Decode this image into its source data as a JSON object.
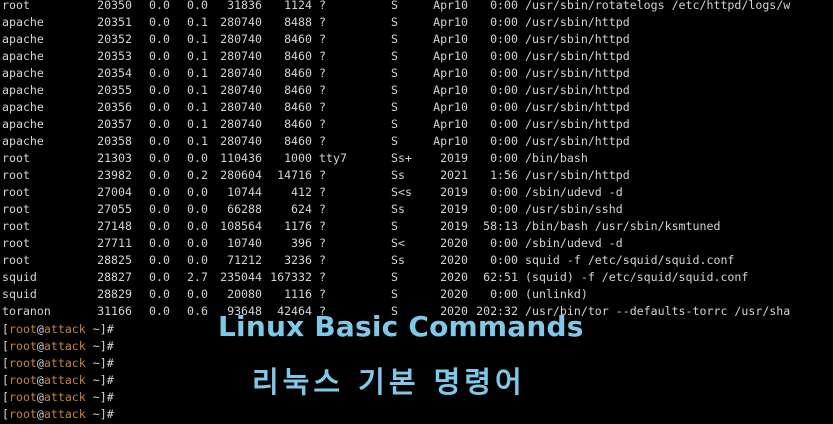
{
  "processes": [
    {
      "user": "root",
      "pid": "20350",
      "cpu": "0.0",
      "mem": "0.0",
      "vsz": "31836",
      "rss": "1124",
      "tty": "?",
      "stat": "S",
      "start": "Apr10",
      "time": "0:00",
      "command": "/usr/sbin/rotatelogs /etc/httpd/logs/w"
    },
    {
      "user": "apache",
      "pid": "20351",
      "cpu": "0.0",
      "mem": "0.1",
      "vsz": "280740",
      "rss": "8488",
      "tty": "?",
      "stat": "S",
      "start": "Apr10",
      "time": "0:00",
      "command": "/usr/sbin/httpd"
    },
    {
      "user": "apache",
      "pid": "20352",
      "cpu": "0.0",
      "mem": "0.1",
      "vsz": "280740",
      "rss": "8460",
      "tty": "?",
      "stat": "S",
      "start": "Apr10",
      "time": "0:00",
      "command": "/usr/sbin/httpd"
    },
    {
      "user": "apache",
      "pid": "20353",
      "cpu": "0.0",
      "mem": "0.1",
      "vsz": "280740",
      "rss": "8460",
      "tty": "?",
      "stat": "S",
      "start": "Apr10",
      "time": "0:00",
      "command": "/usr/sbin/httpd"
    },
    {
      "user": "apache",
      "pid": "20354",
      "cpu": "0.0",
      "mem": "0.1",
      "vsz": "280740",
      "rss": "8460",
      "tty": "?",
      "stat": "S",
      "start": "Apr10",
      "time": "0:00",
      "command": "/usr/sbin/httpd"
    },
    {
      "user": "apache",
      "pid": "20355",
      "cpu": "0.0",
      "mem": "0.1",
      "vsz": "280740",
      "rss": "8460",
      "tty": "?",
      "stat": "S",
      "start": "Apr10",
      "time": "0:00",
      "command": "/usr/sbin/httpd"
    },
    {
      "user": "apache",
      "pid": "20356",
      "cpu": "0.0",
      "mem": "0.1",
      "vsz": "280740",
      "rss": "8460",
      "tty": "?",
      "stat": "S",
      "start": "Apr10",
      "time": "0:00",
      "command": "/usr/sbin/httpd"
    },
    {
      "user": "apache",
      "pid": "20357",
      "cpu": "0.0",
      "mem": "0.1",
      "vsz": "280740",
      "rss": "8460",
      "tty": "?",
      "stat": "S",
      "start": "Apr10",
      "time": "0:00",
      "command": "/usr/sbin/httpd"
    },
    {
      "user": "apache",
      "pid": "20358",
      "cpu": "0.0",
      "mem": "0.1",
      "vsz": "280740",
      "rss": "8460",
      "tty": "?",
      "stat": "S",
      "start": "Apr10",
      "time": "0:00",
      "command": "/usr/sbin/httpd"
    },
    {
      "user": "root",
      "pid": "21303",
      "cpu": "0.0",
      "mem": "0.0",
      "vsz": "110436",
      "rss": "1000",
      "tty": "tty7",
      "stat": "Ss+",
      "start": "2019",
      "time": "0:00",
      "command": "/bin/bash"
    },
    {
      "user": "root",
      "pid": "23982",
      "cpu": "0.0",
      "mem": "0.2",
      "vsz": "280604",
      "rss": "14716",
      "tty": "?",
      "stat": "Ss",
      "start": "2021",
      "time": "1:56",
      "command": "/usr/sbin/httpd"
    },
    {
      "user": "root",
      "pid": "27004",
      "cpu": "0.0",
      "mem": "0.0",
      "vsz": "10744",
      "rss": "412",
      "tty": "?",
      "stat": "S<s",
      "start": "2019",
      "time": "0:00",
      "command": "/sbin/udevd -d"
    },
    {
      "user": "root",
      "pid": "27055",
      "cpu": "0.0",
      "mem": "0.0",
      "vsz": "66288",
      "rss": "624",
      "tty": "?",
      "stat": "Ss",
      "start": "2019",
      "time": "0:00",
      "command": "/usr/sbin/sshd"
    },
    {
      "user": "root",
      "pid": "27148",
      "cpu": "0.0",
      "mem": "0.0",
      "vsz": "108564",
      "rss": "1176",
      "tty": "?",
      "stat": "S",
      "start": "2019",
      "time": "58:13",
      "command": "/bin/bash /usr/sbin/ksmtuned"
    },
    {
      "user": "root",
      "pid": "27711",
      "cpu": "0.0",
      "mem": "0.0",
      "vsz": "10740",
      "rss": "396",
      "tty": "?",
      "stat": "S<",
      "start": "2020",
      "time": "0:00",
      "command": "/sbin/udevd -d"
    },
    {
      "user": "root",
      "pid": "28825",
      "cpu": "0.0",
      "mem": "0.0",
      "vsz": "71212",
      "rss": "3236",
      "tty": "?",
      "stat": "Ss",
      "start": "2020",
      "time": "0:00",
      "command": "squid -f /etc/squid/squid.conf"
    },
    {
      "user": "squid",
      "pid": "28827",
      "cpu": "0.0",
      "mem": "2.7",
      "vsz": "235044",
      "rss": "167332",
      "tty": "?",
      "stat": "S",
      "start": "2020",
      "time": "62:51",
      "command": "(squid) -f /etc/squid/squid.conf"
    },
    {
      "user": "squid",
      "pid": "28829",
      "cpu": "0.0",
      "mem": "0.0",
      "vsz": "20080",
      "rss": "1116",
      "tty": "?",
      "stat": "S",
      "start": "2020",
      "time": "0:00",
      "command": "(unlinkd)"
    },
    {
      "user": "toranon",
      "pid": "31166",
      "cpu": "0.0",
      "mem": "0.6",
      "vsz": "93648",
      "rss": "42464",
      "tty": "?",
      "stat": "S",
      "start": "2020",
      "time": "202:32",
      "command": "/usr/bin/tor --defaults-torrc /usr/sha"
    }
  ],
  "prompts": [
    {
      "open": "[",
      "user": "root",
      "at": "@",
      "host": "attack",
      "cwd": " ~]#"
    },
    {
      "open": "[",
      "user": "root",
      "at": "@",
      "host": "attack",
      "cwd": " ~]#"
    },
    {
      "open": "[",
      "user": "root",
      "at": "@",
      "host": "attack",
      "cwd": " ~]#"
    },
    {
      "open": "[",
      "user": "root",
      "at": "@",
      "host": "attack",
      "cwd": " ~]#"
    },
    {
      "open": "[",
      "user": "root",
      "at": "@",
      "host": "attack",
      "cwd": " ~]#"
    },
    {
      "open": "[",
      "user": "root",
      "at": "@",
      "host": "attack",
      "cwd": " ~]#"
    }
  ],
  "overlay": {
    "title": "Linux Basic Commands",
    "subtitle": "리눅스 기본 명령어"
  },
  "colors": {
    "background": "#000000",
    "text": "#d4d4d4",
    "prompt_user_host": "#c8823a",
    "overlay_text": "#7fc8e8"
  }
}
